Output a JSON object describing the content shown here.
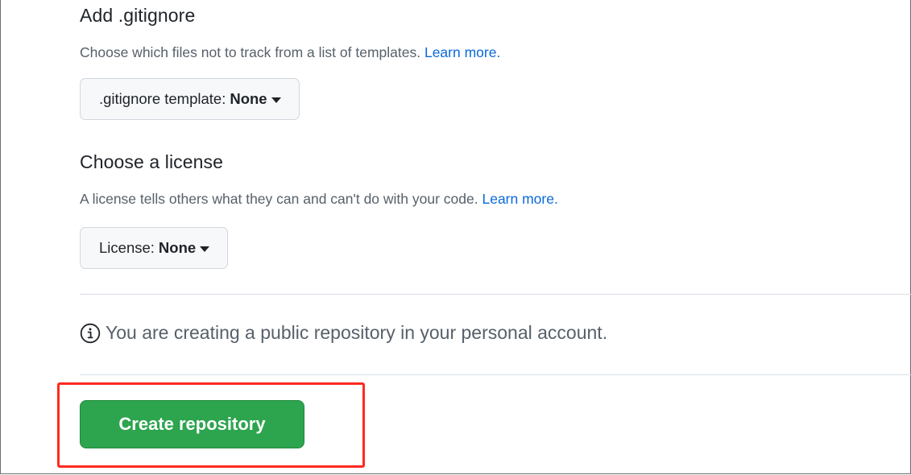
{
  "gitignore": {
    "heading": "Add .gitignore",
    "description": "Choose which files not to track from a list of templates.",
    "learn_more": "Learn more.",
    "select_label": ".gitignore template:",
    "select_value": "None"
  },
  "license": {
    "heading": "Choose a license",
    "description": "A license tells others what they can and can't do with your code.",
    "learn_more": "Learn more.",
    "select_label": "License:",
    "select_value": "None"
  },
  "notice": {
    "icon": "info-icon",
    "text": "You are creating a public repository in your personal account."
  },
  "actions": {
    "create_label": "Create repository"
  },
  "colors": {
    "primary_button": "#2da44e",
    "link": "#0969da",
    "highlight": "#ff2a1f"
  }
}
